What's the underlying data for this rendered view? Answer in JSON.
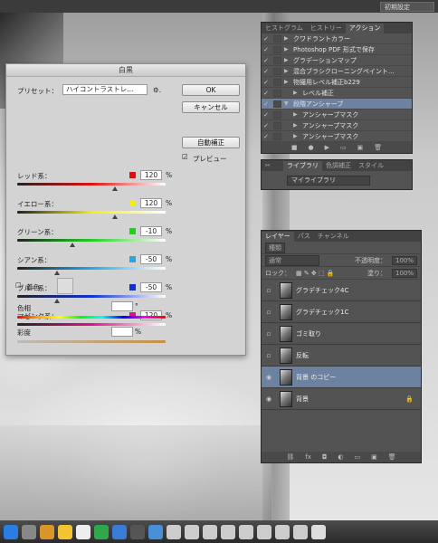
{
  "topbar": {
    "workspace": "初期設定"
  },
  "actions_panel": {
    "tabs": [
      "ヒストグラム",
      "ヒストリー",
      "アクション"
    ],
    "rows": [
      {
        "label": "クワドラントカラー",
        "indent": 1
      },
      {
        "label": "Photoshop PDF 形式で保存",
        "indent": 1
      },
      {
        "label": "グラデーションマップ",
        "indent": 1
      },
      {
        "label": "混合ブラシクローニングペイント...",
        "indent": 1
      },
      {
        "label": "物撮用レベル補正b229",
        "indent": 1
      },
      {
        "label": "レベル補正",
        "indent": 2
      },
      {
        "label": "段階アンシャープ",
        "indent": 1,
        "selected": true
      },
      {
        "label": "アンシャープマスク",
        "indent": 2
      },
      {
        "label": "アンシャープマスク",
        "indent": 2
      },
      {
        "label": "アンシャープマスク",
        "indent": 2
      }
    ]
  },
  "library_panel": {
    "tabs": [
      "ライブラリ",
      "色調補正",
      "スタイル"
    ],
    "selected": "マイライブラリ"
  },
  "layers_panel": {
    "tabs": [
      "レイヤー",
      "パス",
      "チャンネル"
    ],
    "filter": "種類",
    "blend_mode": "通常",
    "opacity_label": "不透明度：",
    "opacity": "100%",
    "lock_label": "ロック：",
    "fill_label": "塗り：",
    "fill": "100%",
    "layers": [
      {
        "name": "グラデチェック4C",
        "visible": false
      },
      {
        "name": "グラデチェック1C",
        "visible": false
      },
      {
        "name": "ゴミ取り",
        "visible": false
      },
      {
        "name": "反転",
        "visible": false
      },
      {
        "name": "背景 のコピー",
        "visible": true,
        "selected": true
      },
      {
        "name": "背景",
        "visible": true,
        "locked": true
      }
    ]
  },
  "dialog": {
    "title": "白黒",
    "preset_label": "プリセット：",
    "preset_value": "ハイコントラストレ...",
    "ok": "OK",
    "cancel": "キャンセル",
    "auto": "自動補正",
    "preview": "プレビュー",
    "tint": "着色",
    "hue": "色相",
    "saturation": "彩度",
    "degree_unit": "°",
    "pct_unit": "%",
    "sliders": [
      {
        "label": "レッド系：",
        "value": "120",
        "color": "#e01010",
        "percent": 0.66
      },
      {
        "label": "イエロー系：",
        "value": "120",
        "color": "#f5f000",
        "percent": 0.66
      },
      {
        "label": "グリーン系：",
        "value": "-10",
        "color": "#20d020",
        "percent": 0.37
      },
      {
        "label": "シアン系：",
        "value": "-50",
        "color": "#20a8e8",
        "percent": 0.27
      },
      {
        "label": "ブルー系：",
        "value": "-50",
        "color": "#1030d0",
        "percent": 0.27
      },
      {
        "label": "マゼンタ系：",
        "value": "120",
        "color": "#e01090",
        "percent": 0.66
      }
    ]
  }
}
